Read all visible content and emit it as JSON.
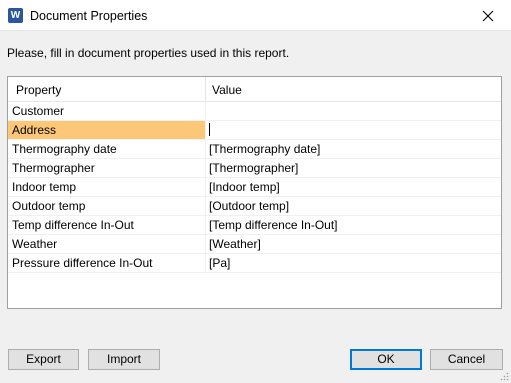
{
  "window": {
    "title": "Document Properties",
    "app_icon_letter": "W",
    "app_icon": "word-icon",
    "close_icon": "close-icon"
  },
  "instructions": "Please, fill in document properties used in this report.",
  "table": {
    "columns": [
      "Property",
      "Value"
    ],
    "rows": [
      {
        "property": "Customer",
        "value": ""
      },
      {
        "property": "Address",
        "value": ""
      },
      {
        "property": "Thermography date",
        "value": "[Thermography date]"
      },
      {
        "property": "Thermographer",
        "value": "[Thermographer]"
      },
      {
        "property": "Indoor temp",
        "value": "[Indoor temp]"
      },
      {
        "property": "Outdoor temp",
        "value": "[Outdoor temp]"
      },
      {
        "property": "Temp difference In-Out",
        "value": "[Temp difference In-Out]"
      },
      {
        "property": "Weather",
        "value": "[Weather]"
      },
      {
        "property": "Pressure difference In-Out",
        "value": "[Pa]"
      }
    ],
    "selected_row_index": 1,
    "selected_color": "#fcc776"
  },
  "buttons": {
    "export": "Export",
    "import": "Import",
    "ok": "OK",
    "cancel": "Cancel"
  },
  "colors": {
    "accent": "#0078d7",
    "word_brand": "#2b579a"
  }
}
